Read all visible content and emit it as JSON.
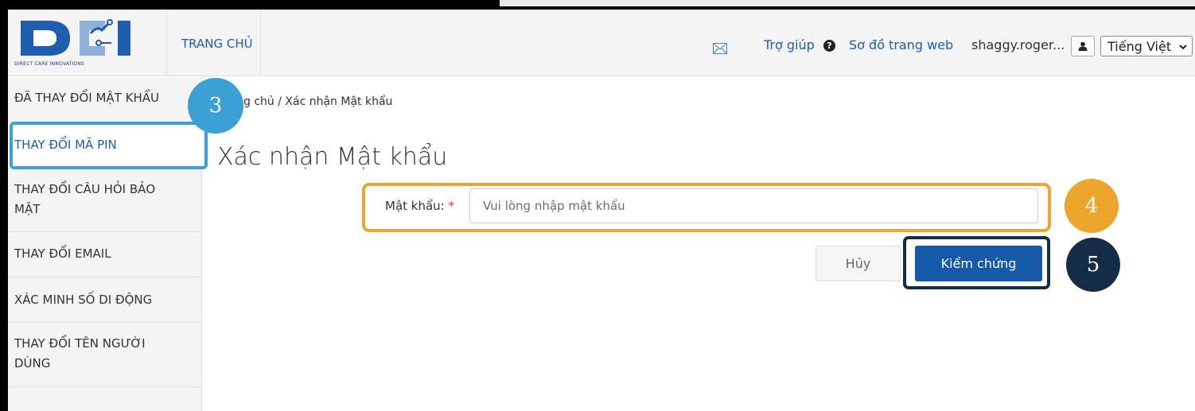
{
  "header": {
    "logo_tagline": "DIRECT CARE INNOVATIONS",
    "home_label": "TRANG CHỦ",
    "help_label": "Trợ giúp",
    "help_icon_glyph": "?",
    "sitemap_label": "Sơ đồ trang web",
    "username": "shaggy.roger...",
    "language": "Tiếng Việt",
    "icons": [
      "mail-icon",
      "help-circle-icon",
      "user-icon",
      "chevron-down-icon"
    ]
  },
  "sidebar": {
    "items": [
      {
        "label": "ĐÃ THAY ĐỔI MẬT KHẨU"
      },
      {
        "label": "THAY ĐỔI MÃ PIN",
        "active": true
      },
      {
        "label": "THAY ĐỔI CÂU HỎI BẢO MẬT"
      },
      {
        "label": "THAY ĐỔI EMAIL"
      },
      {
        "label": "XÁC MINH SỐ DI ĐỘNG"
      },
      {
        "label": "THAY ĐỔI TÊN NGƯỜI DÙNG"
      }
    ]
  },
  "main": {
    "breadcrumb": "g chủ / Xác nhận Mật khẩu",
    "title": "Xác nhận Mật khẩu",
    "password_label": "Mật khẩu:",
    "required_mark": "*",
    "password_placeholder": "Vui lòng nhập mật khẩu",
    "password_value": "",
    "cancel_label": "Hủy",
    "verify_label": "Kiểm chứng"
  },
  "annotations": {
    "step_3": "3",
    "step_4": "4",
    "step_5": "5"
  },
  "colors": {
    "brand_blue": "#1f5db0",
    "verify_button": "#1559a8",
    "step3_highlight": "#3ba1d4",
    "step4_highlight": "#eda52b",
    "step5_highlight": "#152c46"
  }
}
